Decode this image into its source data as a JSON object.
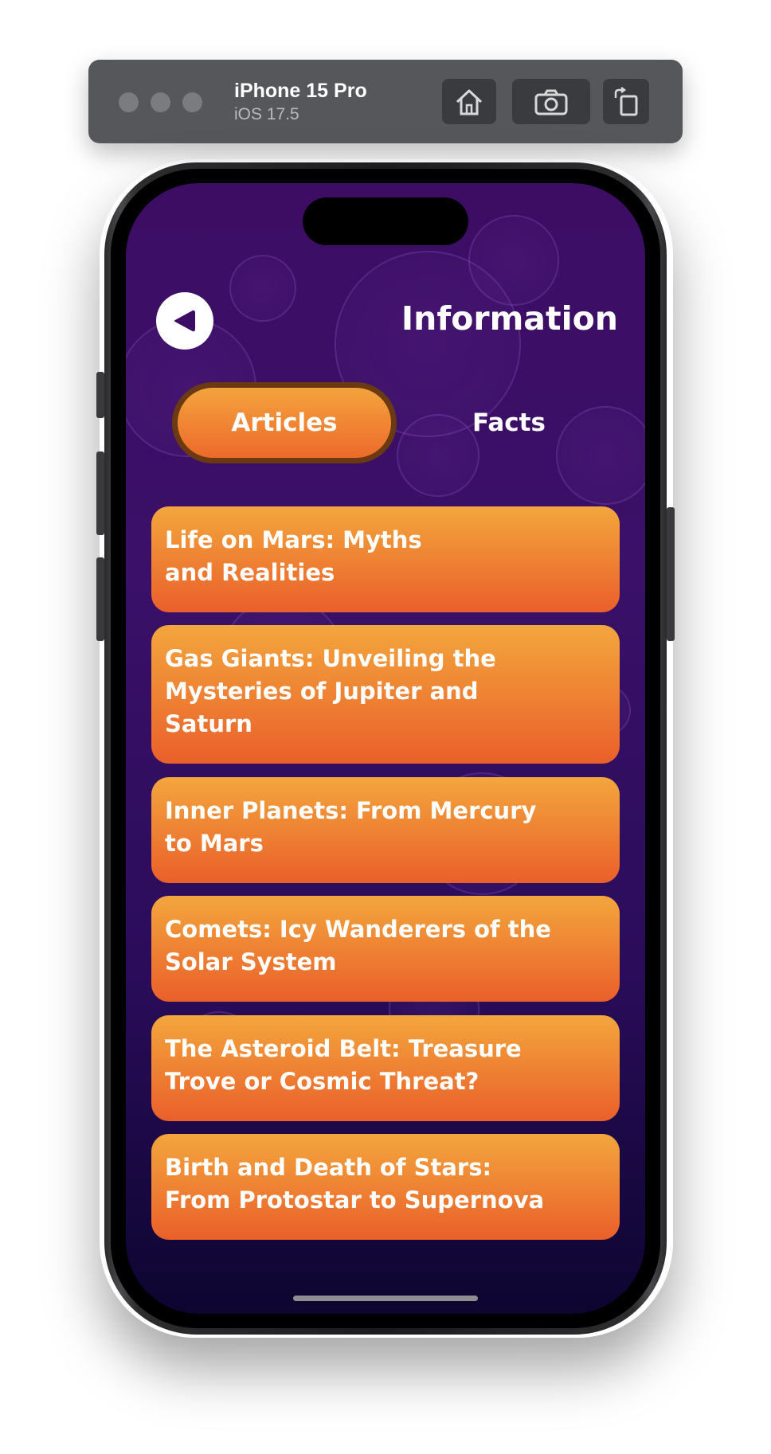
{
  "simulator": {
    "device_name": "iPhone 15 Pro",
    "os_version": "iOS 17.5",
    "home_button": "home-icon",
    "screenshot_button": "camera-icon",
    "rotate_button": "rotate-icon"
  },
  "header": {
    "title": "Information",
    "back_icon": "back-arrow-icon"
  },
  "tabs": [
    {
      "label": "Articles",
      "active": true
    },
    {
      "label": "Facts",
      "active": false
    }
  ],
  "articles": [
    {
      "title": "Life on Mars: Myths\nand Realities"
    },
    {
      "title": "Gas Giants: Unveiling the\nMysteries of Jupiter and\nSaturn"
    },
    {
      "title": "Inner Planets: From Mercury\nto Mars"
    },
    {
      "title": "Comets: Icy Wanderers of the\nSolar System"
    },
    {
      "title": "The Asteroid Belt: Treasure\nTrove or Cosmic Threat?"
    },
    {
      "title": "Birth and Death of Stars:\nFrom Protostar to Supernova"
    }
  ],
  "colors": {
    "card_top": "#f3a63d",
    "card_bottom": "#ea5f2a",
    "background_top": "#3d0d64",
    "background_bottom": "#0d0530",
    "tab_border": "#6b3a12"
  }
}
